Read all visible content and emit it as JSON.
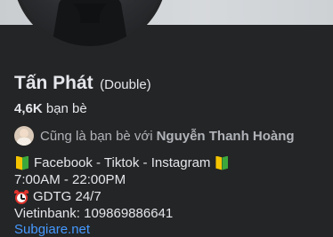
{
  "profile": {
    "name": "Tấn Phát",
    "alternate_name": "(Double)",
    "friends_count": "4,6K",
    "friends_label": "bạn bè",
    "mutual_prefix": "Cũng là bạn bè với",
    "mutual_name": "Nguyễn Thanh Hoàng"
  },
  "bio": {
    "line1": "Facebook - Tiktok - Instagram",
    "line2": "7:00AM - 22:00PM",
    "line3": "GDTG 24/7",
    "line4": "Vietinbank: 109869886641",
    "line5": "Subgiare.net"
  },
  "icons": {
    "badge": "japanese-beginner-badge-icon",
    "clock": "alarm-clock-icon"
  },
  "colors": {
    "background": "#242526",
    "link": "#4599ff",
    "secondary_text": "#b0b3b8"
  }
}
